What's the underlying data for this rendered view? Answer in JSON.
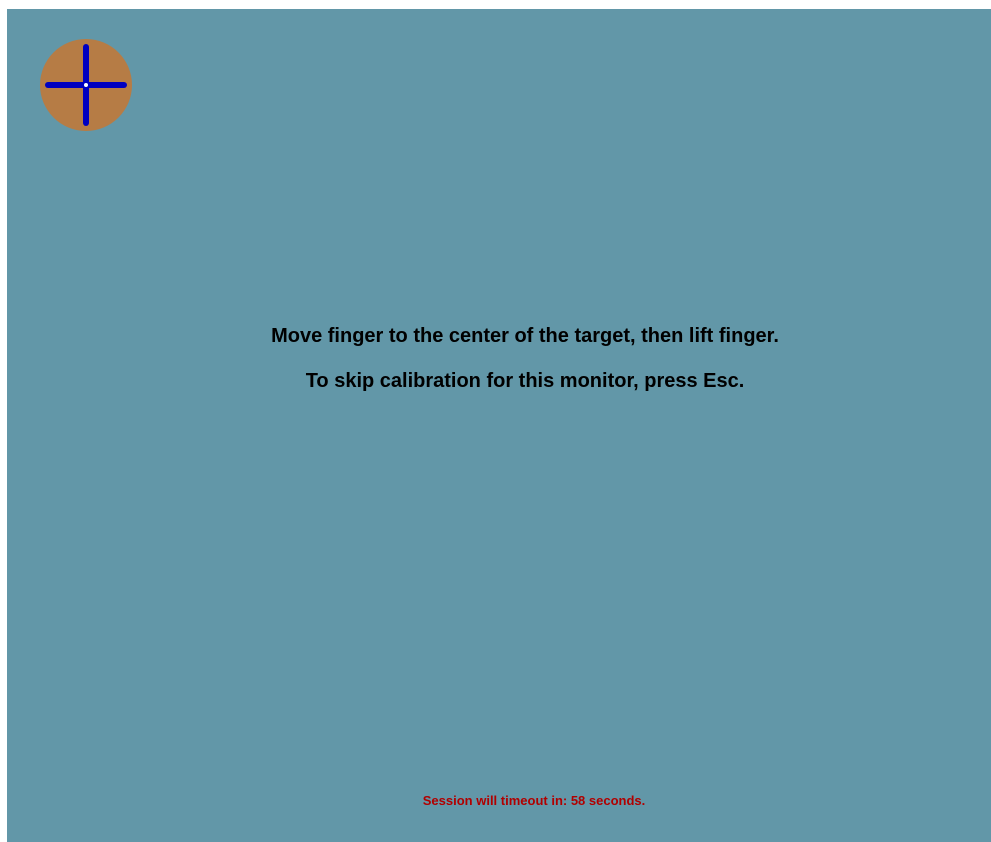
{
  "calibration": {
    "target_icon": "crosshair-target-icon",
    "instruction_line1": "Move finger to the center of the target, then lift finger.",
    "instruction_line2": "To skip calibration for this monitor, press Esc.",
    "timeout_message": "Session will timeout in: 58 seconds."
  },
  "colors": {
    "background": "#6297a8",
    "target_fill": "#b67c45",
    "crosshair": "#0000c0",
    "instruction_text": "#000000",
    "timeout_text": "#b00000"
  }
}
